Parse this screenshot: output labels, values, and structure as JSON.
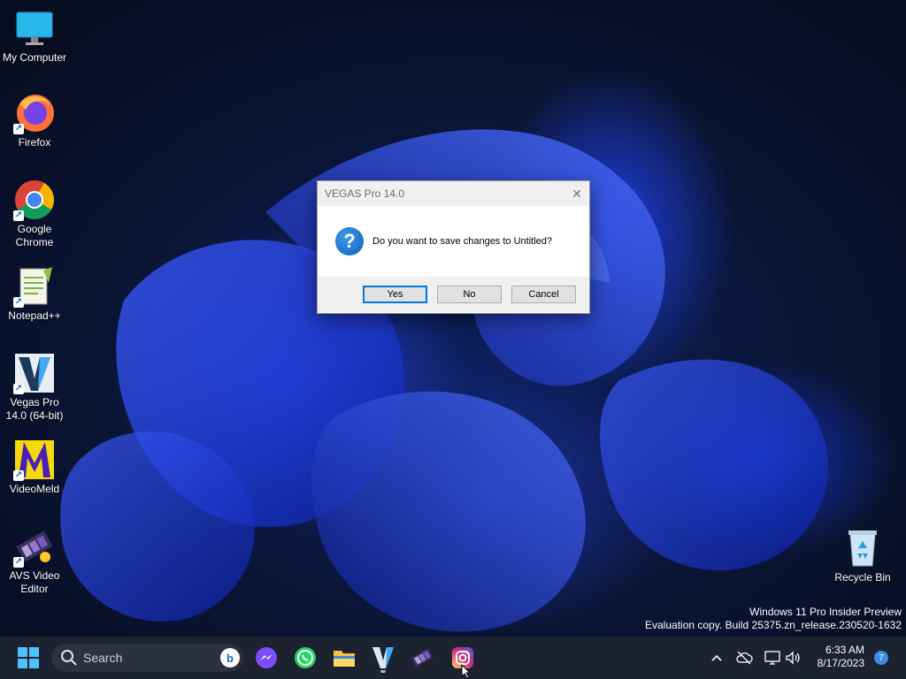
{
  "desktop": {
    "icons": [
      {
        "label": "My Computer",
        "icon": "monitor-icon"
      },
      {
        "label": "Firefox",
        "icon": "firefox-icon"
      },
      {
        "label": "Google Chrome",
        "icon": "chrome-icon"
      },
      {
        "label": "Notepad++",
        "icon": "notepadpp-icon"
      },
      {
        "label": "Vegas Pro 14.0 (64-bit)",
        "icon": "vegas-icon"
      },
      {
        "label": "VideoMeld",
        "icon": "videomeld-icon"
      },
      {
        "label": "AVS Video Editor",
        "icon": "avs-icon"
      },
      {
        "label": "Recycle Bin",
        "icon": "recycle-bin-icon"
      }
    ],
    "watermark": {
      "line1": "Windows 11 Pro Insider Preview",
      "line2": "Evaluation copy. Build 25375.zn_release.230520-1632"
    }
  },
  "dialog": {
    "title": "VEGAS Pro 14.0",
    "close_glyph": "✕",
    "icon": "question-icon",
    "icon_glyph": "?",
    "message": "Do you want to save changes to Untitled?",
    "buttons": {
      "yes": "Yes",
      "no": "No",
      "cancel": "Cancel"
    }
  },
  "taskbar": {
    "search_placeholder": "Search",
    "bing_glyph": "b",
    "apps": [
      "start-icon",
      "messenger-icon",
      "whatsapp-icon",
      "file-explorer-icon",
      "vegas-icon",
      "avs-icon",
      "instagram-icon"
    ],
    "clock_time": "6:33 AM",
    "clock_date": "8/17/2023",
    "notification_count": "7",
    "tray": [
      "chevron-up-icon",
      "cloud-offline-icon",
      "network-icon",
      "volume-icon"
    ]
  },
  "colors": {
    "taskbar_bg": "#1c2230",
    "accent": "#0078d7",
    "wallpaper": "#0a1433"
  }
}
